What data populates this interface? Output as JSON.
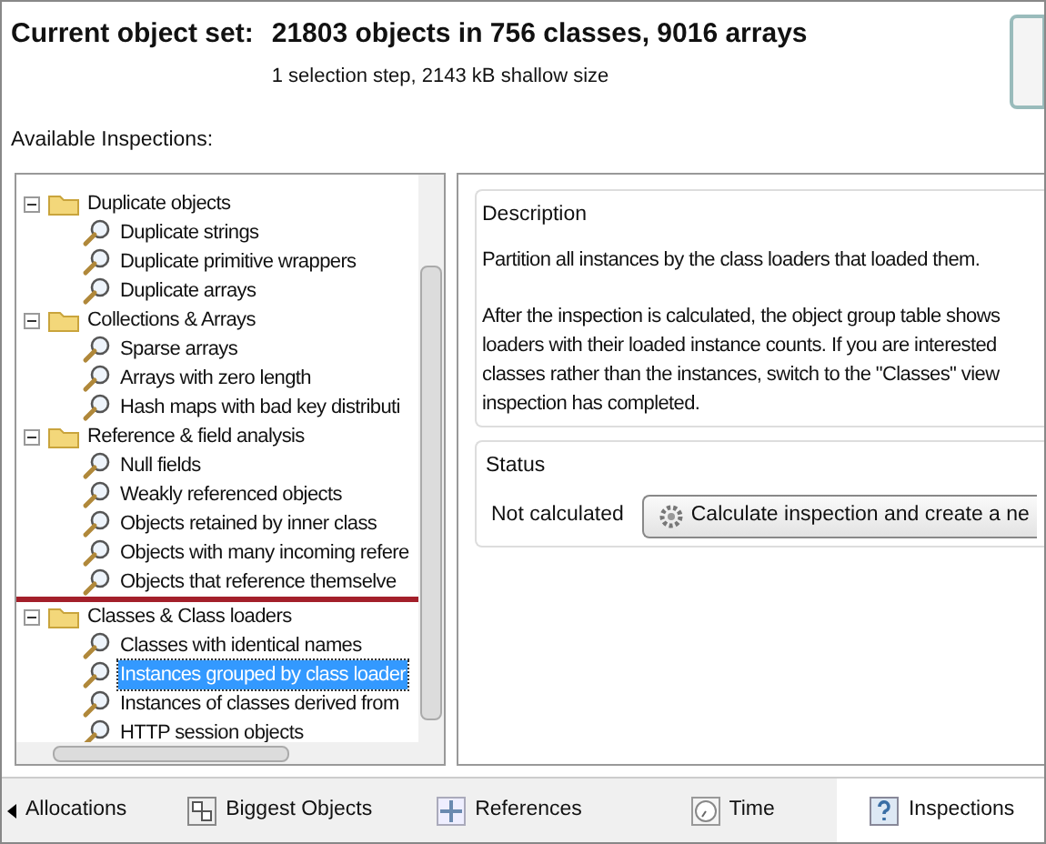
{
  "header": {
    "label": "Current object set:",
    "summary": "21803 objects in 756 classes, 9016 arrays",
    "detail": "1 selection step, 2143 kB shallow size"
  },
  "inspections_label": "Available Inspections:",
  "tree": [
    {
      "label": "Duplicate objects",
      "expanded": true,
      "highlighted": false,
      "children": [
        {
          "label": "Duplicate strings",
          "selected": false
        },
        {
          "label": "Duplicate primitive wrappers",
          "selected": false
        },
        {
          "label": "Duplicate arrays",
          "selected": false
        }
      ]
    },
    {
      "label": "Collections & Arrays",
      "expanded": true,
      "highlighted": false,
      "children": [
        {
          "label": "Sparse arrays",
          "selected": false
        },
        {
          "label": "Arrays with zero length",
          "selected": false
        },
        {
          "label": "Hash maps with bad key distributi",
          "selected": false
        }
      ]
    },
    {
      "label": "Reference & field analysis",
      "expanded": true,
      "highlighted": false,
      "children": [
        {
          "label": "Null fields",
          "selected": false
        },
        {
          "label": "Weakly referenced objects",
          "selected": false
        },
        {
          "label": "Objects retained by inner class",
          "selected": false
        },
        {
          "label": "Objects with many incoming refere",
          "selected": false
        },
        {
          "label": "Objects that reference themselve",
          "selected": false
        }
      ]
    },
    {
      "label": "Classes & Class loaders",
      "expanded": true,
      "highlighted": true,
      "children": [
        {
          "label": "Classes with identical names",
          "selected": false
        },
        {
          "label": "Instances grouped by class loader",
          "selected": true
        },
        {
          "label": "Instances of classes derived from",
          "selected": false
        },
        {
          "label": "HTTP session objects",
          "selected": false
        }
      ]
    }
  ],
  "description": {
    "title": "Description",
    "paragraphs": [
      "Partition all instances by the class loaders that loaded them.",
      "After the inspection is calculated, the object group table shows\nloaders with their loaded instance counts. If you are interested\nclasses rather than the instances, switch to the \"Classes\" view\ninspection has completed."
    ]
  },
  "status": {
    "title": "Status",
    "state": "Not calculated",
    "button": "Calculate inspection and create a ne"
  },
  "tabs": [
    {
      "label": "Allocations",
      "selected": false
    },
    {
      "label": "Biggest Objects",
      "selected": false
    },
    {
      "label": "References",
      "selected": false
    },
    {
      "label": "Time",
      "selected": false
    },
    {
      "label": "Inspections",
      "selected": true
    }
  ]
}
